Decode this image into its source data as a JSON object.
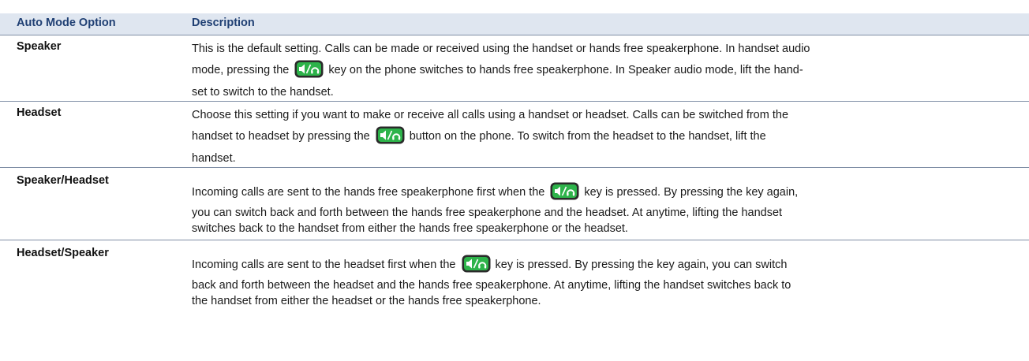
{
  "table": {
    "header": {
      "col_option": "Auto Mode Option",
      "col_description": "Description"
    },
    "rows": [
      {
        "option": "Speaker",
        "lines": [
          [
            "This is the default setting. Calls can be made or received using the handset or hands free speakerphone. In handset audio"
          ],
          [
            "mode, pressing the",
            "key on the phone switches to hands free speakerphone. In Speaker audio mode, lift the hand-"
          ],
          [
            "set to switch to the handset."
          ]
        ]
      },
      {
        "option": "Headset",
        "lines": [
          [
            "Choose this setting if you want to make or receive all calls using a handset or headset. Calls can be switched from the"
          ],
          [
            "handset to headset by pressing the",
            "button on the phone. To switch from the headset to the handset, lift the"
          ],
          [
            "handset."
          ]
        ]
      },
      {
        "option": "Speaker/Headset",
        "lines": [
          [
            "Incoming calls are sent to the hands free speakerphone first when the",
            "key is pressed. By pressing the key again,"
          ],
          [
            "you can switch back and forth between the hands free speakerphone and the headset. At anytime, lifting the handset"
          ],
          [
            "switches back to the handset from either the hands free speakerphone or the headset."
          ]
        ]
      },
      {
        "option": "Headset/Speaker",
        "lines": [
          [
            "Incoming calls are sent to the headset first when the",
            "key is pressed. By pressing the key again, you can switch"
          ],
          [
            "back and forth between the headset and the hands free speakerphone. At anytime, lifting the handset switches back to"
          ],
          [
            "the handset from either the headset or the hands free speakerphone."
          ]
        ]
      }
    ]
  },
  "icons": {
    "speaker_key": "speakerphone-headset-key-icon"
  },
  "colors": {
    "header_bg": "#dfe6f0",
    "header_text": "#1f3f73",
    "rule": "#7f8ea5",
    "key_green": "#2db34a"
  }
}
